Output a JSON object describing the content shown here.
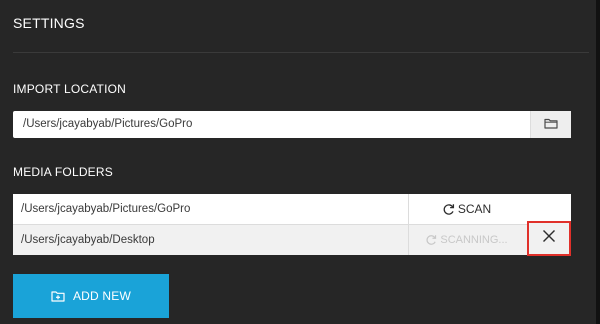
{
  "settings": {
    "title": "SETTINGS"
  },
  "import_location": {
    "label": "IMPORT LOCATION",
    "path": "/Users/jcayabyab/Pictures/GoPro",
    "browse_icon": "folder-icon"
  },
  "media_folders": {
    "label": "MEDIA FOLDERS",
    "rows": [
      {
        "path": "/Users/jcayabyab/Pictures/GoPro",
        "action_label": "SCAN",
        "action_icon": "refresh-icon",
        "action_state": "enabled"
      },
      {
        "path": "/Users/jcayabyab/Desktop",
        "action_label": "SCANNING...",
        "action_icon": "refresh-icon",
        "action_state": "disabled",
        "remove_icon": "close-icon"
      }
    ]
  },
  "add_new": {
    "label": "ADD NEW",
    "icon": "add-folder-icon"
  },
  "colors": {
    "background": "#262626",
    "accent": "#1aa3d8",
    "highlight": "#e0302a"
  }
}
